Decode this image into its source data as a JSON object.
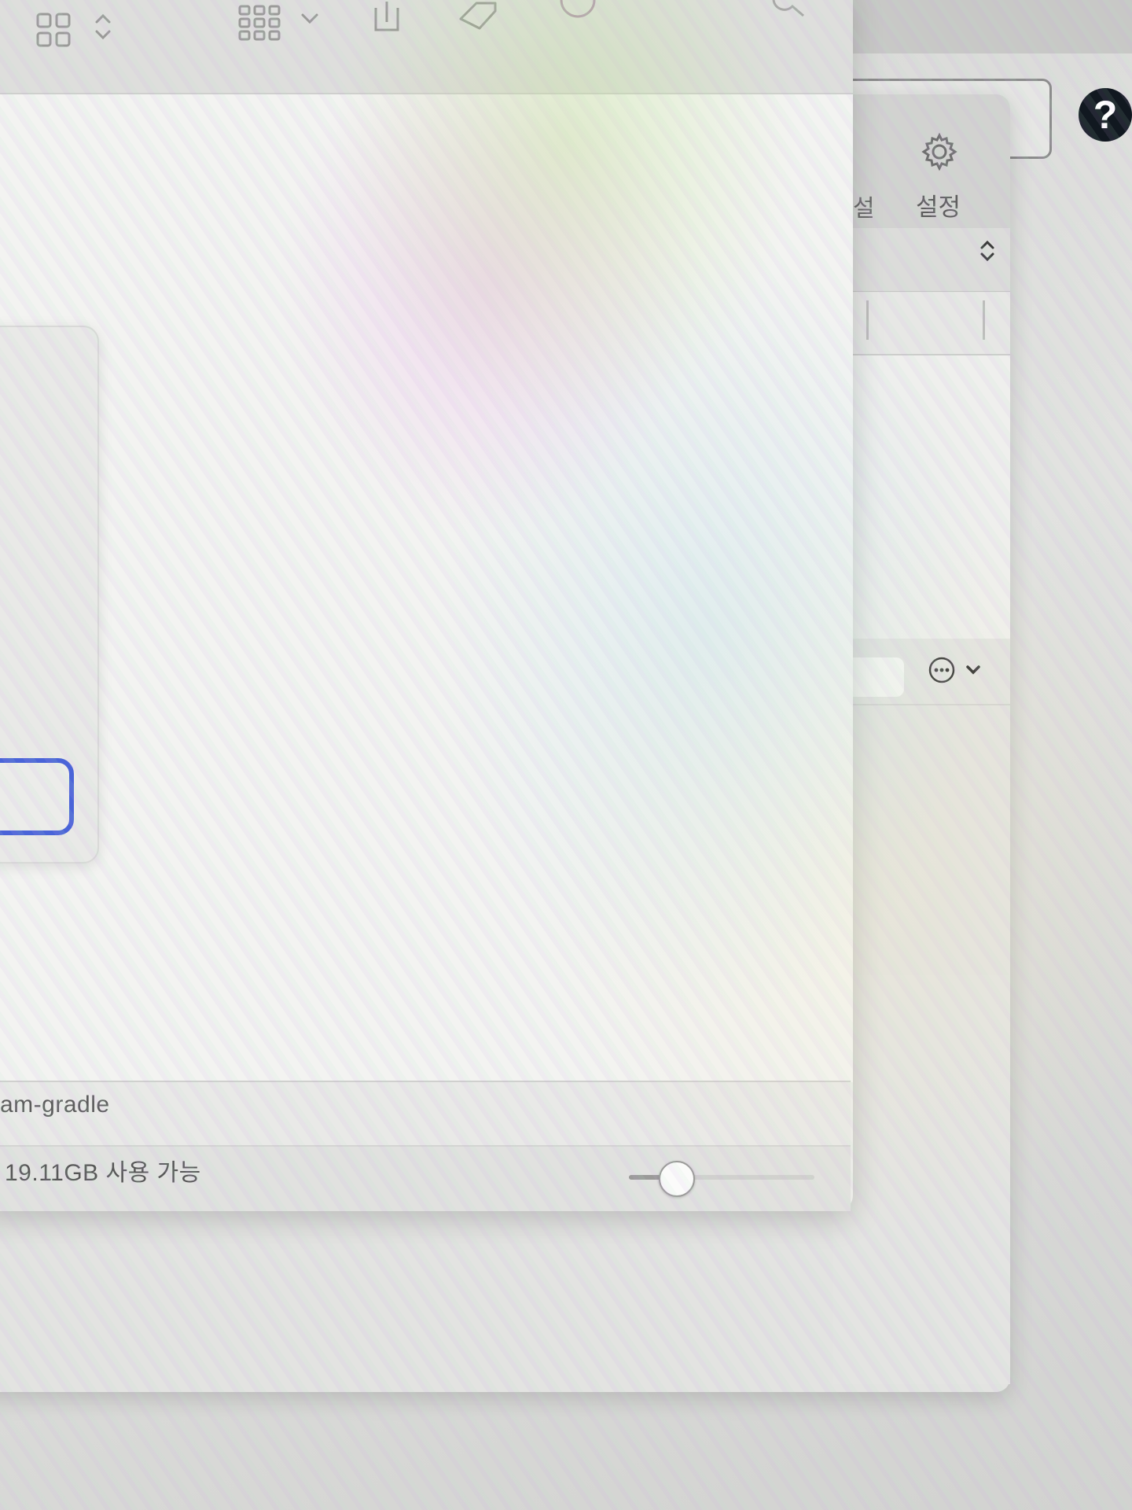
{
  "help_button": {
    "label": "?"
  },
  "settings_window": {
    "tabs": [
      {
        "label": "설",
        "icon": ""
      },
      {
        "label": "설정",
        "icon": "gear-icon"
      }
    ]
  },
  "finder_window": {
    "toolbar": {
      "icons": [
        "view-grid-icon",
        "updown-chevron-icon",
        "group-grid-icon",
        "chevron-down-icon",
        "share-icon",
        "tag-icon",
        "more-icon",
        "search-icon"
      ]
    },
    "path_bar": {
      "label": "am-gradle"
    },
    "status_bar": {
      "label": "19.11GB 사용 가능"
    },
    "icon_size_slider": {
      "value": 0.25
    }
  },
  "colors": {
    "focus_ring": "#4a64d8",
    "help_button": "#111820"
  }
}
